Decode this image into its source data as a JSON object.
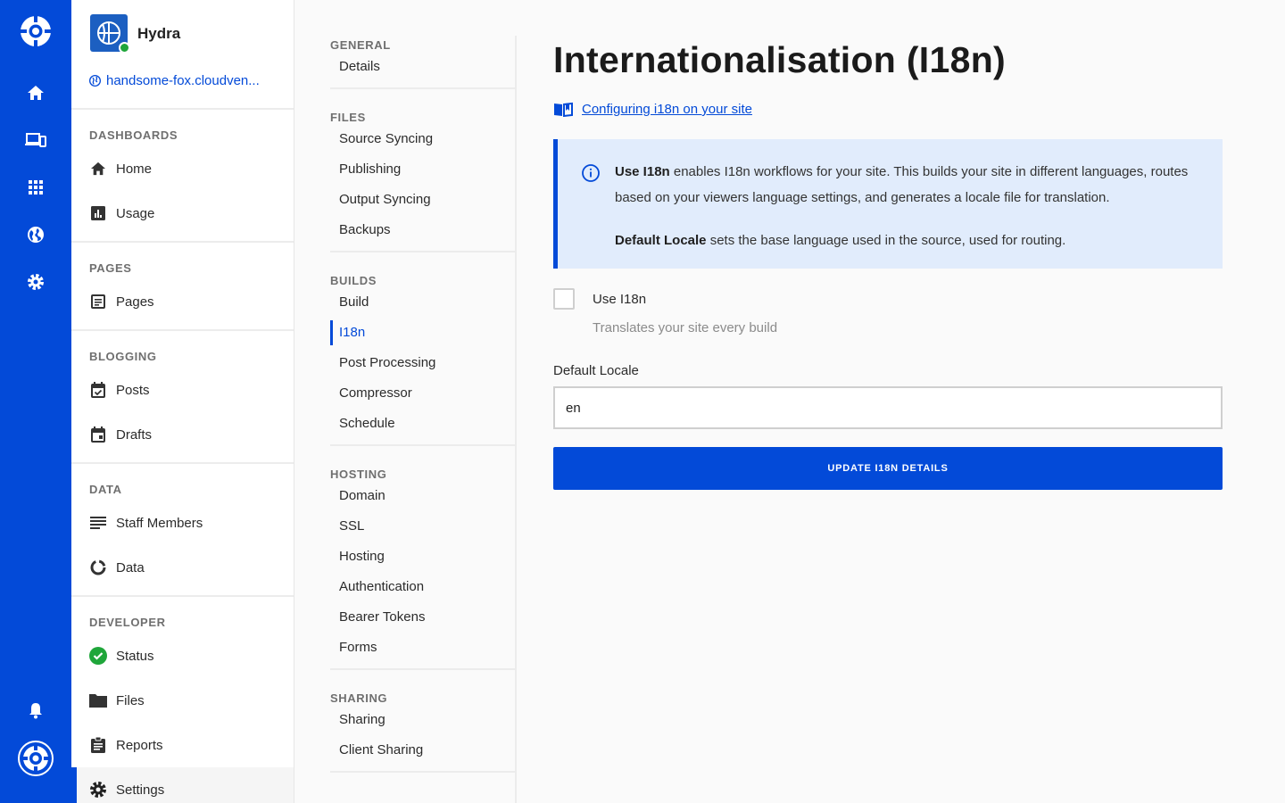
{
  "rail": {
    "items": [
      "logo-icon",
      "home-icon",
      "devices-icon",
      "apps-grid-icon",
      "globe-icon",
      "gear-icon",
      "bell-icon",
      "account-icon"
    ],
    "color": "#034ad8"
  },
  "site": {
    "name": "Hydra",
    "url": "handsome-fox.cloudven...",
    "status": "online"
  },
  "sidebar": {
    "sections": [
      {
        "title": "DASHBOARDS",
        "items": [
          {
            "label": "Home",
            "icon": "home-icon"
          },
          {
            "label": "Usage",
            "icon": "bar-chart-icon"
          }
        ]
      },
      {
        "title": "PAGES",
        "items": [
          {
            "label": "Pages",
            "icon": "page-icon"
          }
        ]
      },
      {
        "title": "BLOGGING",
        "items": [
          {
            "label": "Posts",
            "icon": "calendar-check-icon"
          },
          {
            "label": "Drafts",
            "icon": "calendar-icon"
          }
        ]
      },
      {
        "title": "DATA",
        "items": [
          {
            "label": "Staff Members",
            "icon": "list-icon"
          },
          {
            "label": "Data",
            "icon": "donut-icon"
          }
        ]
      },
      {
        "title": "DEVELOPER",
        "items": [
          {
            "label": "Status",
            "icon": "check-circle-icon"
          },
          {
            "label": "Files",
            "icon": "folder-icon"
          },
          {
            "label": "Reports",
            "icon": "clipboard-icon"
          },
          {
            "label": "Settings",
            "icon": "gear-icon"
          }
        ]
      }
    ],
    "active": "Settings"
  },
  "settings_nav": {
    "groups": [
      {
        "title": "GENERAL",
        "items": [
          "Details"
        ]
      },
      {
        "title": "FILES",
        "items": [
          "Source Syncing",
          "Publishing",
          "Output Syncing",
          "Backups"
        ]
      },
      {
        "title": "BUILDS",
        "items": [
          "Build",
          "I18n",
          "Post Processing",
          "Compressor",
          "Schedule"
        ]
      },
      {
        "title": "HOSTING",
        "items": [
          "Domain",
          "SSL",
          "Hosting",
          "Authentication",
          "Bearer Tokens",
          "Forms"
        ]
      },
      {
        "title": "SHARING",
        "items": [
          "Sharing",
          "Client Sharing"
        ]
      }
    ],
    "active": "I18n"
  },
  "main": {
    "title": "Internationalisation (I18n)",
    "doc_link": "Configuring i18n on your site",
    "info": {
      "p1_bold": "Use I18n",
      "p1_rest": " enables I18n workflows for your site. This builds your site in different languages, routes based on your viewers language settings, and generates a locale file for translation.",
      "p2_bold": "Default Locale",
      "p2_rest": " sets the base language used in the source, used for routing."
    },
    "use_i18n": {
      "label": "Use I18n",
      "help": "Translates your site every build",
      "checked": false
    },
    "default_locale": {
      "label": "Default Locale",
      "value": "en"
    },
    "submit_label": "UPDATE I18N DETAILS"
  }
}
